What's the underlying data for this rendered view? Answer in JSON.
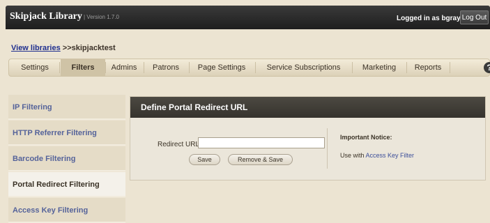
{
  "header": {
    "app_title": "Skipjack Library",
    "version": "| Version 1.7.0",
    "logged_in": "Logged in as bgray",
    "logout_label": "Log Out"
  },
  "breadcrumb": {
    "link": "View libraries",
    "current": " >>skipjacktest"
  },
  "nav": {
    "tabs": [
      "Settings",
      "Filters",
      "Admins",
      "Patrons",
      "Page Settings",
      "Service Subscriptions",
      "Marketing",
      "Reports"
    ],
    "active": "Filters",
    "help_icon": "help-icon"
  },
  "sidebar": {
    "items": [
      "IP Filtering",
      "HTTP Referrer Filtering",
      "Barcode Filtering",
      "Portal Redirect Filtering",
      "Access Key Filtering"
    ],
    "active": "Portal Redirect Filtering"
  },
  "panel": {
    "title": "Define Portal Redirect URL",
    "redirect_label": "Redirect URL:",
    "redirect_value": "",
    "save_label": "Save",
    "remove_save_label": "Remove & Save",
    "notice_title": "Important Notice:",
    "notice_prefix": "Use with ",
    "notice_link": "Access Key Filter"
  }
}
